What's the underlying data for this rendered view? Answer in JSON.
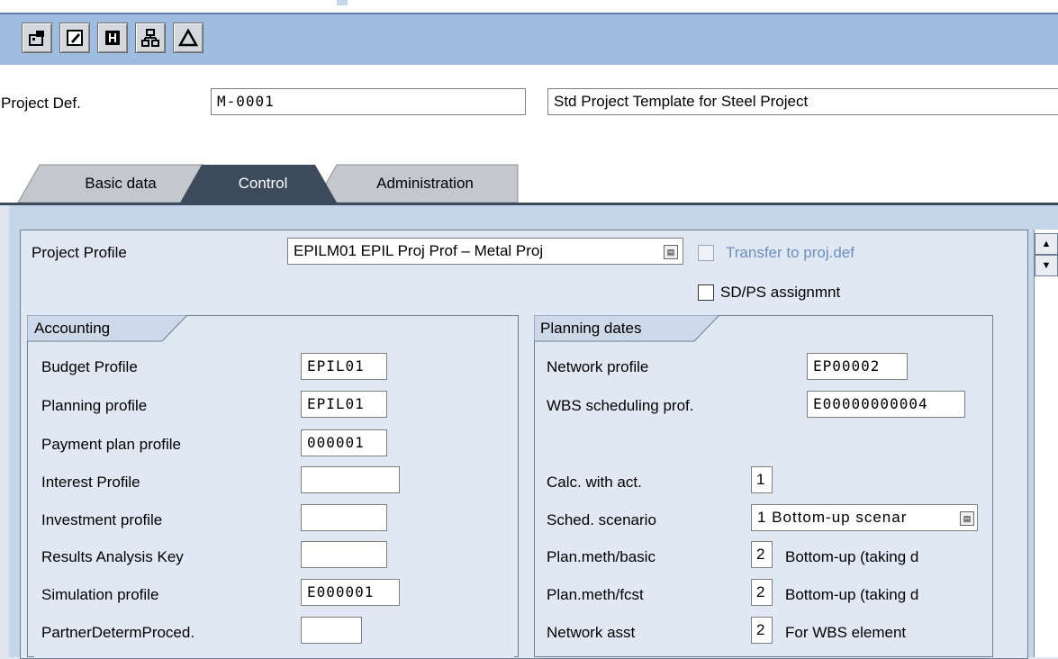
{
  "toolbar": {
    "buttons": [
      {
        "icon": "project-icon"
      },
      {
        "icon": "edit-icon"
      },
      {
        "icon": "info-icon"
      },
      {
        "icon": "hierarchy-icon"
      },
      {
        "icon": "warning-icon"
      }
    ]
  },
  "header": {
    "project_def_label": "Project Def.",
    "project_def_value": "M-0001",
    "project_desc_value": "Std Project Template for Steel Project"
  },
  "tabs": [
    {
      "label": "Basic data"
    },
    {
      "label": "Control"
    },
    {
      "label": "Administration"
    }
  ],
  "control": {
    "project_profile_label": "Project Profile",
    "project_profile_value": "EPILM01 EPIL Proj Prof – Metal Proj",
    "transfer_label": "Transfer to proj.def",
    "sdps_label": "SD/PS assignmnt"
  },
  "accounting": {
    "title": "Accounting",
    "rows": [
      {
        "label": "Budget Profile",
        "value": "EPIL01"
      },
      {
        "label": "Planning profile",
        "value": "EPIL01"
      },
      {
        "label": "Payment plan profile",
        "value": "000001"
      },
      {
        "label": "Interest Profile",
        "value": ""
      },
      {
        "label": "Investment profile",
        "value": ""
      },
      {
        "label": "Results Analysis Key",
        "value": ""
      },
      {
        "label": "Simulation profile",
        "value": "E000001"
      },
      {
        "label": "PartnerDetermProced.",
        "value": ""
      }
    ]
  },
  "planning": {
    "title": "Planning dates",
    "network_profile_label": "Network profile",
    "network_profile_value": "EP00002",
    "wbs_sched_label": "WBS scheduling prof.",
    "wbs_sched_value": "E00000000004",
    "calc_label": "Calc. with act.",
    "calc_value": "1",
    "sched_scenario_label": "Sched. scenario",
    "sched_scenario_value": "1 Bottom-up scenar",
    "plan_basic_label": "Plan.meth/basic",
    "plan_basic_value": "2",
    "plan_basic_text": "Bottom-up (taking d",
    "plan_fcst_label": "Plan.meth/fcst",
    "plan_fcst_value": "2",
    "plan_fcst_text": "Bottom-up (taking d",
    "network_asst_label": "Network asst",
    "network_asst_value": "2",
    "network_asst_text": "For WBS element"
  }
}
